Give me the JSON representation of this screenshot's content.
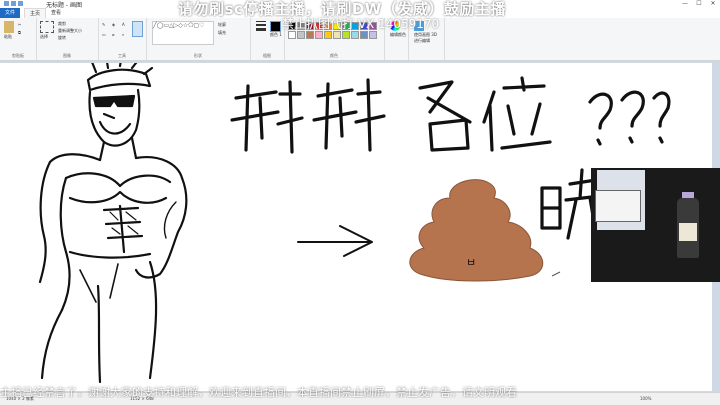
{
  "window": {
    "title": "无标题 - 画图",
    "controls": [
      "—",
      "☐",
      "✕"
    ]
  },
  "tabs": {
    "file": "文件",
    "home": "主页",
    "view": "查看"
  },
  "ribbon": {
    "groups": {
      "clipboard": {
        "label": "剪贴板",
        "paste": "粘贴"
      },
      "image": {
        "label": "图像",
        "select": "选择",
        "crop": "裁剪",
        "resize": "重新调整大小",
        "rotate": "旋转"
      },
      "tools": {
        "label": "工具"
      },
      "shapes": {
        "label": "形状",
        "outline": "轮廓",
        "fill": "填充"
      },
      "size": {
        "label": "粗细"
      },
      "colors": {
        "label": "颜色",
        "color1": "颜色 1",
        "color2": "颜色 2",
        "edit": "编辑颜色"
      },
      "paint3d": {
        "label": "使用画图 3D 进行编辑"
      }
    },
    "swatch_colors": [
      "#000000",
      "#7f7f7f",
      "#880015",
      "#ed1c24",
      "#ff7f27",
      "#fff200",
      "#22b14c",
      "#00a2e8",
      "#3f48cc",
      "#a349a4",
      "#ffffff",
      "#c3c3c3",
      "#b97a57",
      "#ffaec9",
      "#ffc90e",
      "#efe4b0",
      "#b5e61d",
      "#99d9ea",
      "#7092be",
      "#c8bfe7"
    ]
  },
  "overlay": {
    "title": "请勿刷sc停播主播，请刷DW（发威）鼓励主播",
    "id_line": "禁止扒图代打 VX 14059170",
    "ticker": "主播已经禁言了，谢谢大家的支持和理解，欢迎来到直播间，本直播间禁止刷屏，禁止发广告，请文明观看"
  },
  "canvas": {
    "ink_color": "#111111",
    "poop_color": "#b5734e",
    "poop_label": "ㅂ"
  },
  "status": {
    "size": "1040 × 2 像素",
    "zoom": "100%",
    "dims": "1152 × 648"
  }
}
